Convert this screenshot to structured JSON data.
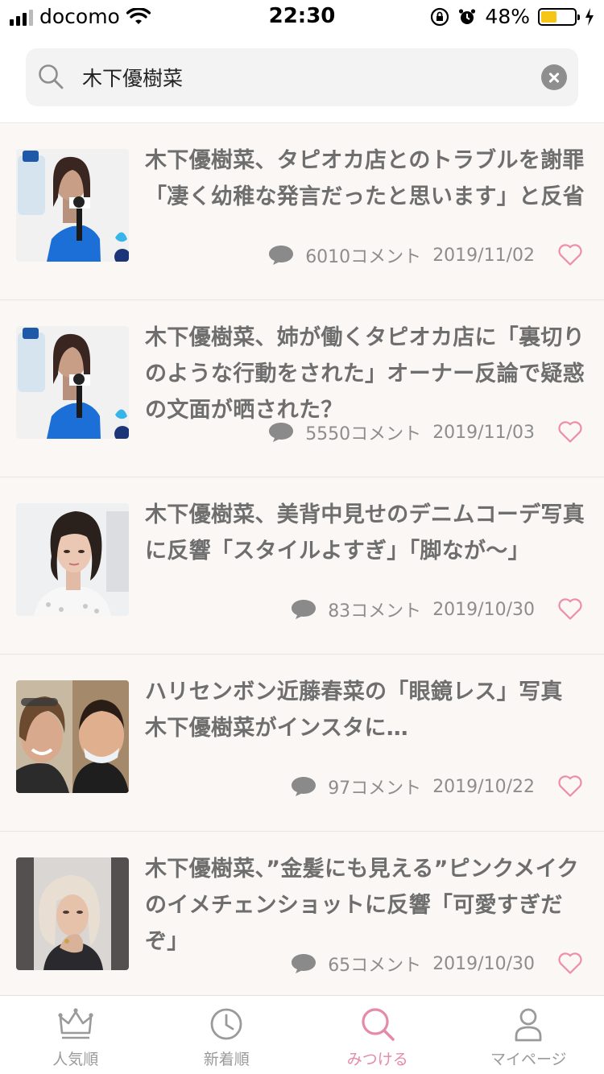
{
  "status_bar": {
    "carrier": "docomo",
    "time": "22:30",
    "battery": "48%",
    "battery_level": 0.48
  },
  "search": {
    "value": "木下優樹菜",
    "placeholder": ""
  },
  "articles": [
    {
      "title": "木下優樹菜、タピオカ店とのトラブルを謝罪「凄く幼稚な発言だったと思います」と反省",
      "comments": "6010コメント",
      "date": "2019/11/02",
      "thumb_icon": "photo-woman-blue-dress-microphone"
    },
    {
      "title": "木下優樹菜、姉が働くタピオカ店に「裏切りのような行動をされた」オーナー反論で疑惑の文面が晒された？",
      "comments": "5550コメント",
      "date": "2019/11/03",
      "thumb_icon": "photo-woman-blue-dress-microphone"
    },
    {
      "title": "木下優樹菜、美背中見せのデニムコーデ写真に反響「スタイルよすぎ」「脚なが〜」",
      "comments": "83コメント",
      "date": "2019/10/30",
      "thumb_icon": "photo-woman-portrait"
    },
    {
      "title": "ハリセンボン近藤春菜の「眼鏡レス」写真　木下優樹菜がインスタに…",
      "comments": "97コメント",
      "date": "2019/10/22",
      "thumb_icon": "photo-two-people-selfie"
    },
    {
      "title": "木下優樹菜、”金髪にも見える”ピンクメイクのイメチェンショットに反響「可愛すぎだぞ」",
      "comments": "65コメント",
      "date": "2019/10/30",
      "thumb_icon": "photo-woman-blonde"
    }
  ],
  "tabs": [
    {
      "label": "人気順",
      "icon": "crown-icon",
      "active": false
    },
    {
      "label": "新着順",
      "icon": "clock-icon",
      "active": false
    },
    {
      "label": "みつける",
      "icon": "search-icon",
      "active": true
    },
    {
      "label": "マイページ",
      "icon": "person-icon",
      "active": false
    }
  ],
  "colors": {
    "accent": "#e48aab",
    "heart": "#ec8fa5",
    "title_text": "#6e6e6e",
    "list_bg": "#faf7f4"
  }
}
